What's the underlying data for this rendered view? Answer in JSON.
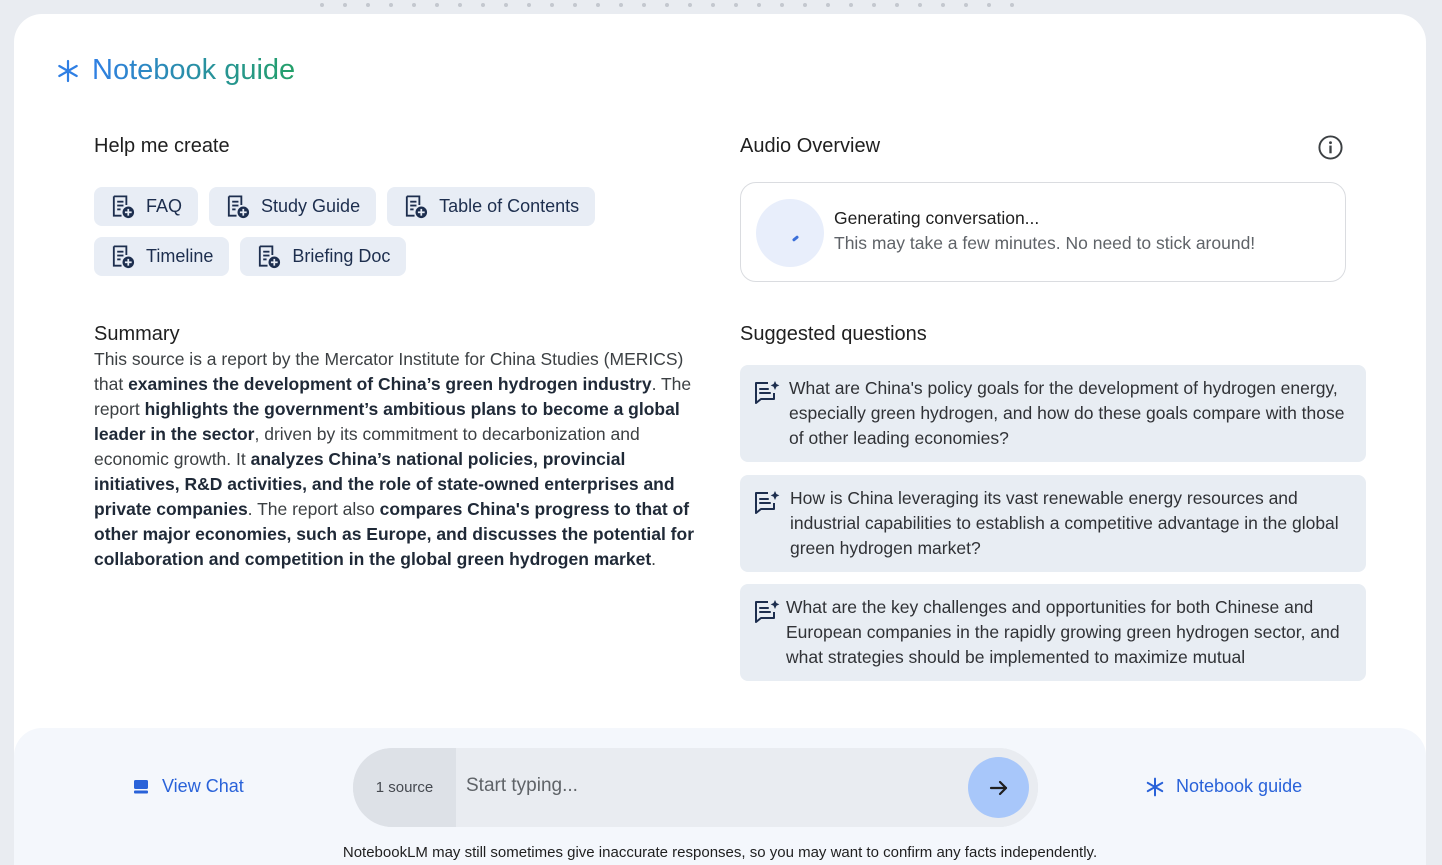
{
  "guide": {
    "title": "Notebook guide"
  },
  "help": {
    "heading": "Help me create",
    "chips": [
      {
        "label": "FAQ"
      },
      {
        "label": "Study Guide"
      },
      {
        "label": "Table of Contents"
      },
      {
        "label": "Timeline"
      },
      {
        "label": "Briefing Doc"
      }
    ]
  },
  "summary": {
    "heading": "Summary",
    "segments": [
      {
        "text": "This source is a report by the Mercator Institute for China Studies (MERICS) that ",
        "bold": false
      },
      {
        "text": "examines the development of China’s green hydrogen industry",
        "bold": true
      },
      {
        "text": ". The report ",
        "bold": false
      },
      {
        "text": "highlights the government’s ambitious plans to become a global leader in the sector",
        "bold": true
      },
      {
        "text": ", driven by its commitment to decarbonization and economic growth. It ",
        "bold": false
      },
      {
        "text": "analyzes China’s national policies, provincial initiatives, R&D activities, and the role of state-owned enterprises and private companies",
        "bold": true
      },
      {
        "text": ". The report also ",
        "bold": false
      },
      {
        "text": "compares China's progress to that of other major economies, such as Europe, and discusses the potential for collaboration and competition in the global green hydrogen market",
        "bold": true
      },
      {
        "text": ".",
        "bold": false
      }
    ]
  },
  "audio": {
    "heading": "Audio Overview",
    "status": "Generating conversation...",
    "note": "This may take a few minutes. No need to stick around!"
  },
  "suggested": {
    "heading": "Suggested questions",
    "questions": [
      {
        "text": "What are China's policy goals for the development of hydrogen energy, especially green hydrogen, and how do these goals compare with those of other leading economies?"
      },
      {
        "text": "How is China leveraging its vast renewable energy resources and industrial capabilities to establish a competitive advantage in the global green hydrogen market?"
      },
      {
        "text": "What are the key challenges and opportunities for both Chinese and European companies in the rapidly growing green hydrogen sector, and what strategies should be implemented to maximize mutual"
      }
    ]
  },
  "footer": {
    "view_chat": "View Chat",
    "source_count": "1 source",
    "input_placeholder": "Start typing...",
    "notebook_guide": "Notebook guide",
    "disclaimer": "NotebookLM may still sometimes give inaccurate responses, so you may want to confirm any facts independently."
  },
  "colors": {
    "accent_blue": "#2962d9",
    "chip_bg": "#e8edf5",
    "question_bg": "#e8edf3",
    "send_button": "#a8c7fa"
  },
  "icons": {
    "title": "sparkle-icon",
    "chip": "note-add-icon",
    "info": "info-icon",
    "question": "chat-question-icon",
    "view_chat": "chat-panel-icon",
    "send": "arrow-right-icon"
  }
}
